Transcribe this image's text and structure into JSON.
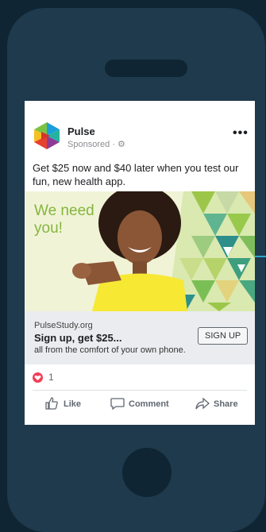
{
  "ad": {
    "page_name": "Pulse",
    "sponsored": "Sponsored · ⚙",
    "more_icon": "•••",
    "body_text": "Get $25 now and $40 later when you test our fun, new health app.",
    "image": {
      "headline_line1": "We need",
      "headline_line2": "you!"
    },
    "link": {
      "domain": "PulseStudy.org",
      "title": "Sign up, get $25...",
      "description": "all from the comfort of your own phone.",
      "cta": "SIGN UP"
    },
    "reaction_count": "1",
    "actions": {
      "like": "Like",
      "comment": "Comment",
      "share": "Share"
    }
  },
  "colors": {
    "phone_body": "#1f3a4d",
    "background": "#0f2533",
    "headline_green": "#84b640",
    "heart": "#f33e58"
  }
}
